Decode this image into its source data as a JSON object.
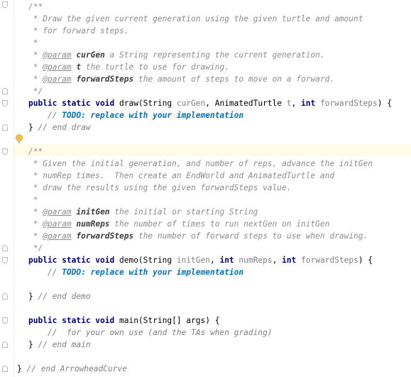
{
  "editor": {
    "lines": [
      {
        "tokens": [
          {
            "t": "/**",
            "c": "cm"
          }
        ]
      },
      {
        "tokens": [
          {
            "t": " * Draw the given current generation using the given turtle and amount",
            "c": "cm"
          }
        ]
      },
      {
        "tokens": [
          {
            "t": " * for forward steps.",
            "c": "cm"
          }
        ]
      },
      {
        "tokens": [
          {
            "t": " *",
            "c": "cm"
          }
        ]
      },
      {
        "tokens": [
          {
            "t": " * ",
            "c": "cm"
          },
          {
            "t": "@param",
            "c": "tag"
          },
          {
            "t": " ",
            "c": "cm"
          },
          {
            "t": "curGen",
            "c": "pname"
          },
          {
            "t": " a String representing the current generation.",
            "c": "cm"
          }
        ]
      },
      {
        "tokens": [
          {
            "t": " * ",
            "c": "cm"
          },
          {
            "t": "@param",
            "c": "tag"
          },
          {
            "t": " ",
            "c": "cm"
          },
          {
            "t": "t",
            "c": "pname"
          },
          {
            "t": " the turtle to use for drawing.",
            "c": "cm"
          }
        ]
      },
      {
        "tokens": [
          {
            "t": " * ",
            "c": "cm"
          },
          {
            "t": "@param",
            "c": "tag"
          },
          {
            "t": " ",
            "c": "cm"
          },
          {
            "t": "forwardSteps",
            "c": "pname"
          },
          {
            "t": " the amount of steps to move on a forward.",
            "c": "cm"
          }
        ]
      },
      {
        "tokens": [
          {
            "t": " */",
            "c": "cm"
          }
        ]
      },
      {
        "tokens": [
          {
            "t": "public static void ",
            "c": "kw"
          },
          {
            "t": "draw(String ",
            "c": "id"
          },
          {
            "t": "curGen",
            "c": "param"
          },
          {
            "t": ", AnimatedTurtle ",
            "c": "id"
          },
          {
            "t": "t",
            "c": "param"
          },
          {
            "t": ", ",
            "c": "id"
          },
          {
            "t": "int ",
            "c": "kw"
          },
          {
            "t": "forwardSteps",
            "c": "param"
          },
          {
            "t": ") {",
            "c": "id"
          }
        ]
      },
      {
        "tokens": [
          {
            "t": "    // ",
            "c": "sl"
          },
          {
            "t": "TODO: replace with your implementation",
            "c": "todo"
          }
        ]
      },
      {
        "tokens": [
          {
            "t": "} ",
            "c": "id"
          },
          {
            "t": "// end draw",
            "c": "sl"
          }
        ]
      },
      {
        "tokens": []
      },
      {
        "tokens": [
          {
            "t": "/**",
            "c": "cm"
          }
        ]
      },
      {
        "tokens": [
          {
            "t": " * Given the initial generation, and number of reps, advance the initGen",
            "c": "cm"
          }
        ]
      },
      {
        "tokens": [
          {
            "t": " * numRep times.  Then create an EndWorld and AnimatedTurtle and",
            "c": "cm"
          }
        ]
      },
      {
        "tokens": [
          {
            "t": " * draw the results using the given forwardSteps value.",
            "c": "cm"
          }
        ]
      },
      {
        "tokens": [
          {
            "t": " *",
            "c": "cm"
          }
        ]
      },
      {
        "tokens": [
          {
            "t": " * ",
            "c": "cm"
          },
          {
            "t": "@param",
            "c": "tag"
          },
          {
            "t": " ",
            "c": "cm"
          },
          {
            "t": "initGen",
            "c": "pname"
          },
          {
            "t": " the initial or starting String",
            "c": "cm"
          }
        ]
      },
      {
        "tokens": [
          {
            "t": " * ",
            "c": "cm"
          },
          {
            "t": "@param",
            "c": "tag"
          },
          {
            "t": " ",
            "c": "cm"
          },
          {
            "t": "numReps",
            "c": "pname"
          },
          {
            "t": " the number of times to run nextGen on initGen",
            "c": "cm"
          }
        ]
      },
      {
        "tokens": [
          {
            "t": " * ",
            "c": "cm"
          },
          {
            "t": "@param",
            "c": "tag"
          },
          {
            "t": " ",
            "c": "cm"
          },
          {
            "t": "forwardSteps",
            "c": "pname"
          },
          {
            "t": " the number of forward steps to use when drawing.",
            "c": "cm"
          }
        ]
      },
      {
        "tokens": [
          {
            "t": " */",
            "c": "cm"
          }
        ]
      },
      {
        "tokens": [
          {
            "t": "public static void ",
            "c": "kw"
          },
          {
            "t": "demo(String ",
            "c": "id"
          },
          {
            "t": "initGen",
            "c": "param"
          },
          {
            "t": ", ",
            "c": "id"
          },
          {
            "t": "int ",
            "c": "kw"
          },
          {
            "t": "numReps",
            "c": "param"
          },
          {
            "t": ", ",
            "c": "id"
          },
          {
            "t": "int ",
            "c": "kw"
          },
          {
            "t": "forwardSteps",
            "c": "param"
          },
          {
            "t": ") {",
            "c": "id"
          }
        ]
      },
      {
        "tokens": [
          {
            "t": "    // ",
            "c": "sl"
          },
          {
            "t": "TODO: replace with your implementation",
            "c": "todo"
          }
        ]
      },
      {
        "tokens": []
      },
      {
        "tokens": [
          {
            "t": "} ",
            "c": "id"
          },
          {
            "t": "// end demo",
            "c": "sl"
          }
        ]
      },
      {
        "tokens": []
      },
      {
        "tokens": [
          {
            "t": "public static void ",
            "c": "kw"
          },
          {
            "t": "main(String[] args) {",
            "c": "id"
          }
        ]
      },
      {
        "tokens": [
          {
            "t": "    //  for your own use (and the TAs when grading)",
            "c": "sl"
          }
        ]
      },
      {
        "tokens": [
          {
            "t": "} ",
            "c": "id"
          },
          {
            "t": "// end main",
            "c": "sl"
          }
        ]
      },
      {
        "tokens": []
      },
      {
        "tokens": [
          {
            "t": "} ",
            "c": "id"
          },
          {
            "t": "// end ArrowheadCurve",
            "c": "sl"
          }
        ]
      }
    ]
  }
}
